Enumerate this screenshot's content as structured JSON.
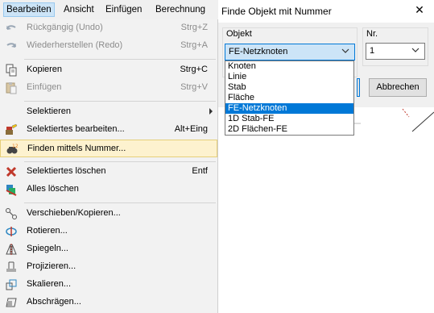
{
  "menubar": {
    "items": [
      {
        "label": "Bearbeiten",
        "underline": "B",
        "active": true
      },
      {
        "label": "Ansicht",
        "underline": "A"
      },
      {
        "label": "Einfügen",
        "underline": "E"
      },
      {
        "label": "Berechnung",
        "underline": "r"
      }
    ]
  },
  "menu": {
    "items": [
      {
        "label": "Rückgängig (Undo)",
        "shortcut": "Strg+Z",
        "icon": "undo-icon",
        "disabled": true
      },
      {
        "label": "Wiederherstellen (Redo)",
        "shortcut": "Strg+A",
        "icon": "redo-icon",
        "disabled": true
      },
      {
        "label": "Kopieren",
        "shortcut": "Strg+C",
        "icon": "copy-icon"
      },
      {
        "label": "Einfügen",
        "shortcut": "Strg+V",
        "icon": "paste-icon",
        "disabled": true
      },
      {
        "label": "Selektieren",
        "shortcut": "",
        "icon": "",
        "submenu": true
      },
      {
        "label": "Selektiertes bearbeiten...",
        "shortcut": "Alt+Eing",
        "icon": "edit-selection-icon"
      },
      {
        "label": "Finden mittels Nummer...",
        "shortcut": "",
        "icon": "find-by-number-icon",
        "highlighted": true
      },
      {
        "label": "Selektiertes löschen",
        "shortcut": "Entf",
        "icon": "delete-selection-icon"
      },
      {
        "label": "Alles löschen",
        "shortcut": "",
        "icon": "delete-all-icon"
      },
      {
        "label": "Verschieben/Kopieren...",
        "shortcut": "",
        "icon": "move-copy-icon"
      },
      {
        "label": "Rotieren...",
        "shortcut": "",
        "icon": "rotate-icon"
      },
      {
        "label": "Spiegeln...",
        "shortcut": "",
        "icon": "mirror-icon"
      },
      {
        "label": "Projizieren...",
        "shortcut": "",
        "icon": "project-icon"
      },
      {
        "label": "Skalieren...",
        "shortcut": "",
        "icon": "scale-icon"
      },
      {
        "label": "Abschrägen...",
        "shortcut": "",
        "icon": "shear-icon"
      }
    ]
  },
  "dialog": {
    "title": "Finde Objekt mit Nummer",
    "close_icon": "close-icon",
    "objekt_label": "Objekt",
    "objekt_value": "FE-Netzknoten",
    "nr_label": "Nr.",
    "nr_value": "1",
    "cancel_label": "Abbrechen",
    "options": [
      "Knoten",
      "Linie",
      "Stab",
      "Fläche",
      "FE-Netzknoten",
      "1D Stab-FE",
      "2D Flächen-FE"
    ],
    "selected_option": "FE-Netzknoten"
  },
  "colors": {
    "highlight_bg": "#fdf2cf",
    "highlight_border": "#e6cf7a",
    "selection_blue": "#0078d7",
    "menubar_active": "#cce4f7"
  }
}
